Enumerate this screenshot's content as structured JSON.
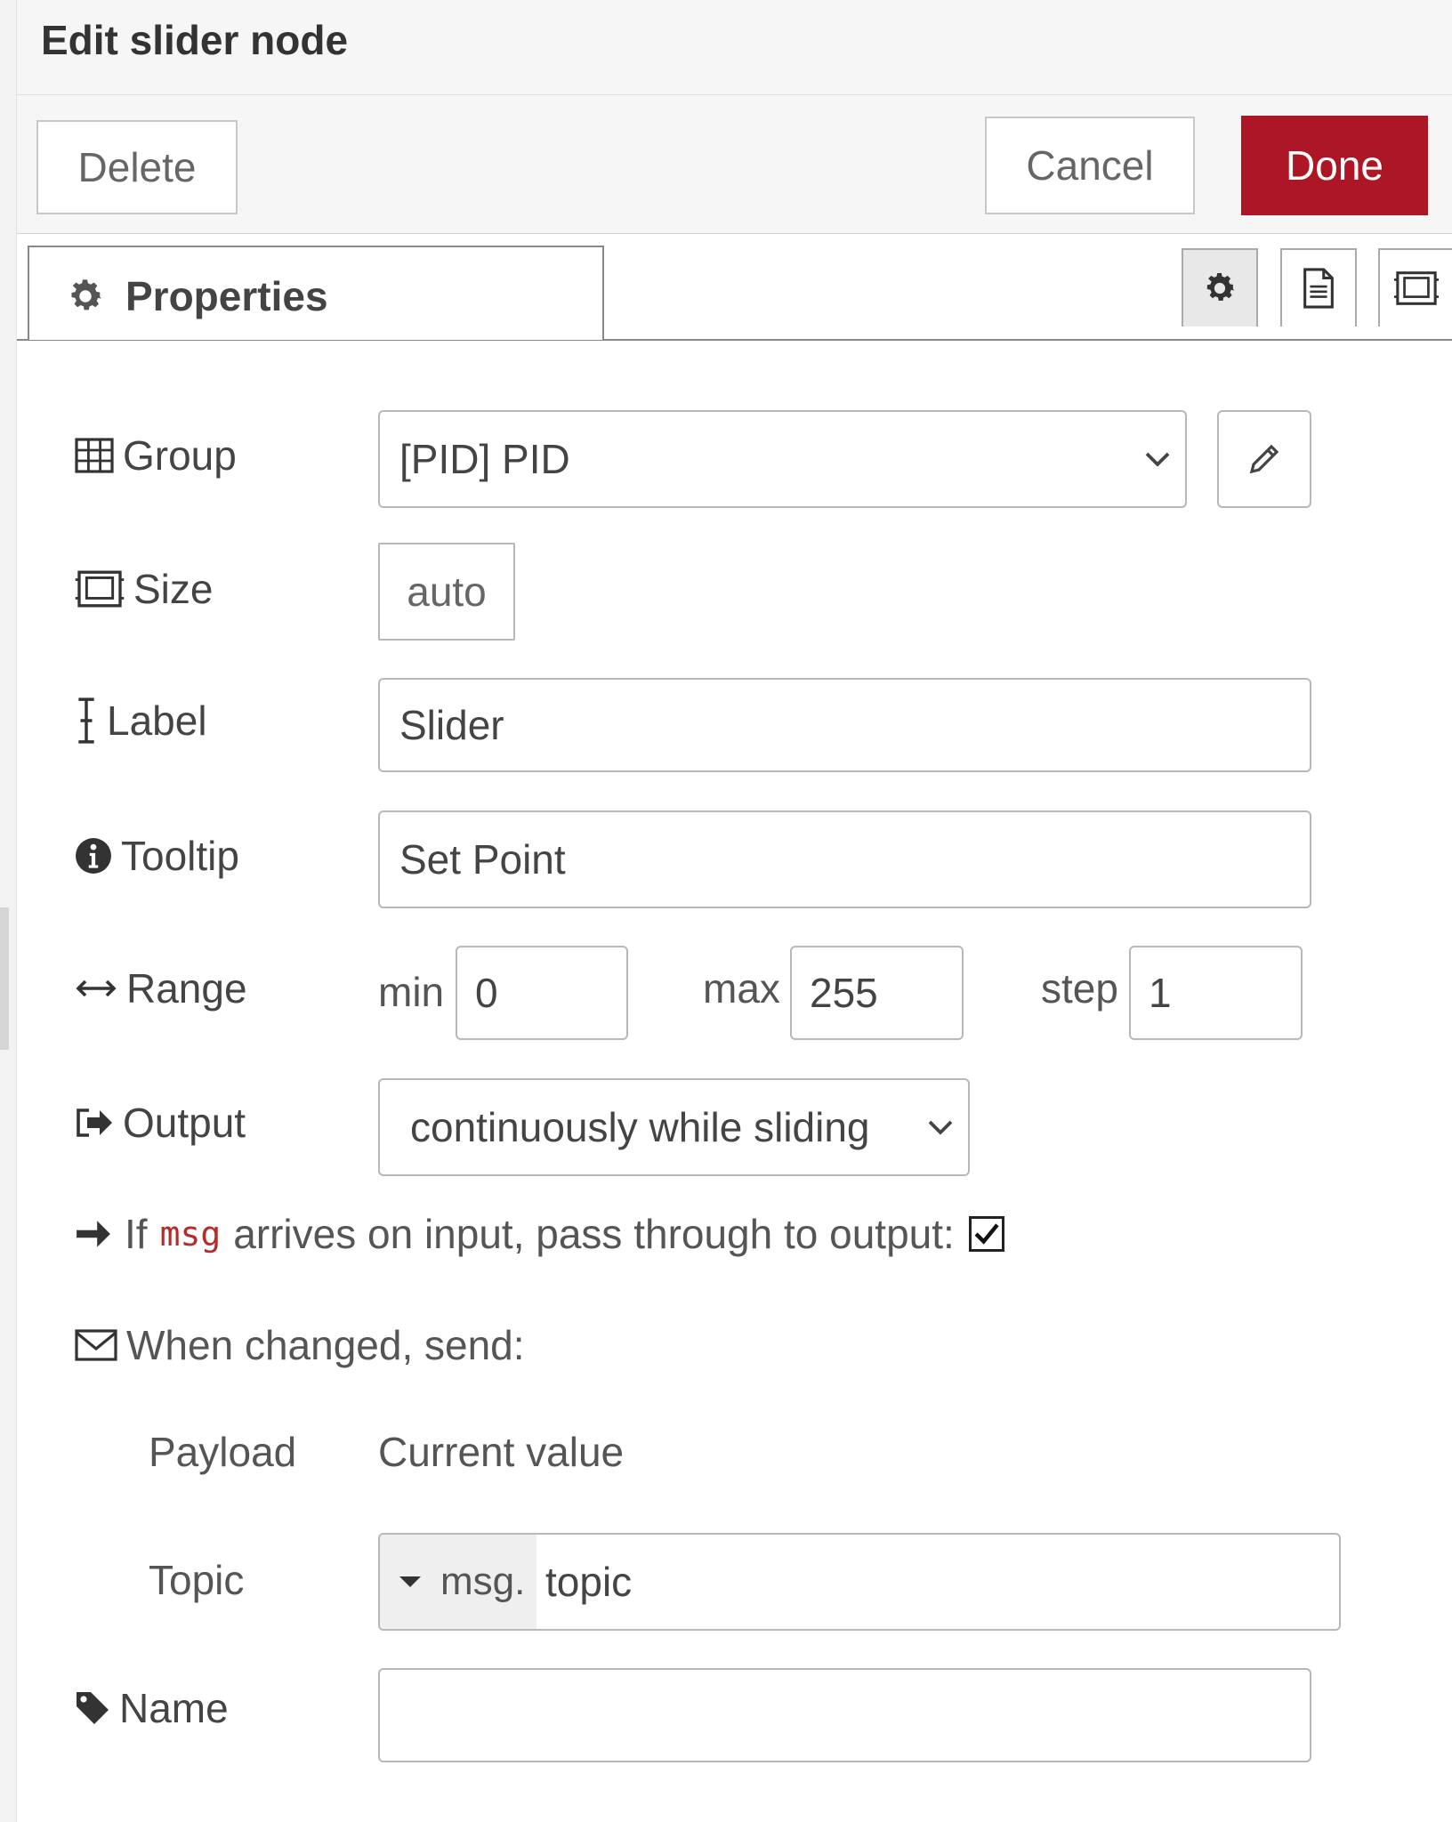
{
  "header": {
    "title": "Edit slider node"
  },
  "toolbar": {
    "delete_label": "Delete",
    "cancel_label": "Cancel",
    "done_label": "Done",
    "done_color": "#ad1625"
  },
  "tabs": {
    "properties_label": "Properties"
  },
  "form": {
    "group": {
      "label": "Group",
      "value": "[PID] PID"
    },
    "size": {
      "label": "Size",
      "value": "auto"
    },
    "label_field": {
      "label": "Label",
      "value": "Slider"
    },
    "tooltip": {
      "label": "Tooltip",
      "value": "Set Point"
    },
    "range": {
      "label": "Range",
      "min_label": "min",
      "min_value": "0",
      "max_label": "max",
      "max_value": "255",
      "step_label": "step",
      "step_value": "1"
    },
    "output": {
      "label": "Output",
      "value": "continuously while sliding"
    },
    "passthrough": {
      "prefix": "If",
      "code": "msg",
      "suffix": "arrives on input, pass through to output:",
      "checked": true
    },
    "when_changed": {
      "label": "When changed, send:"
    },
    "payload": {
      "label": "Payload",
      "value": "Current value"
    },
    "topic": {
      "label": "Topic",
      "type_prefix": "msg.",
      "value": "topic"
    },
    "name": {
      "label": "Name",
      "value": ""
    }
  }
}
